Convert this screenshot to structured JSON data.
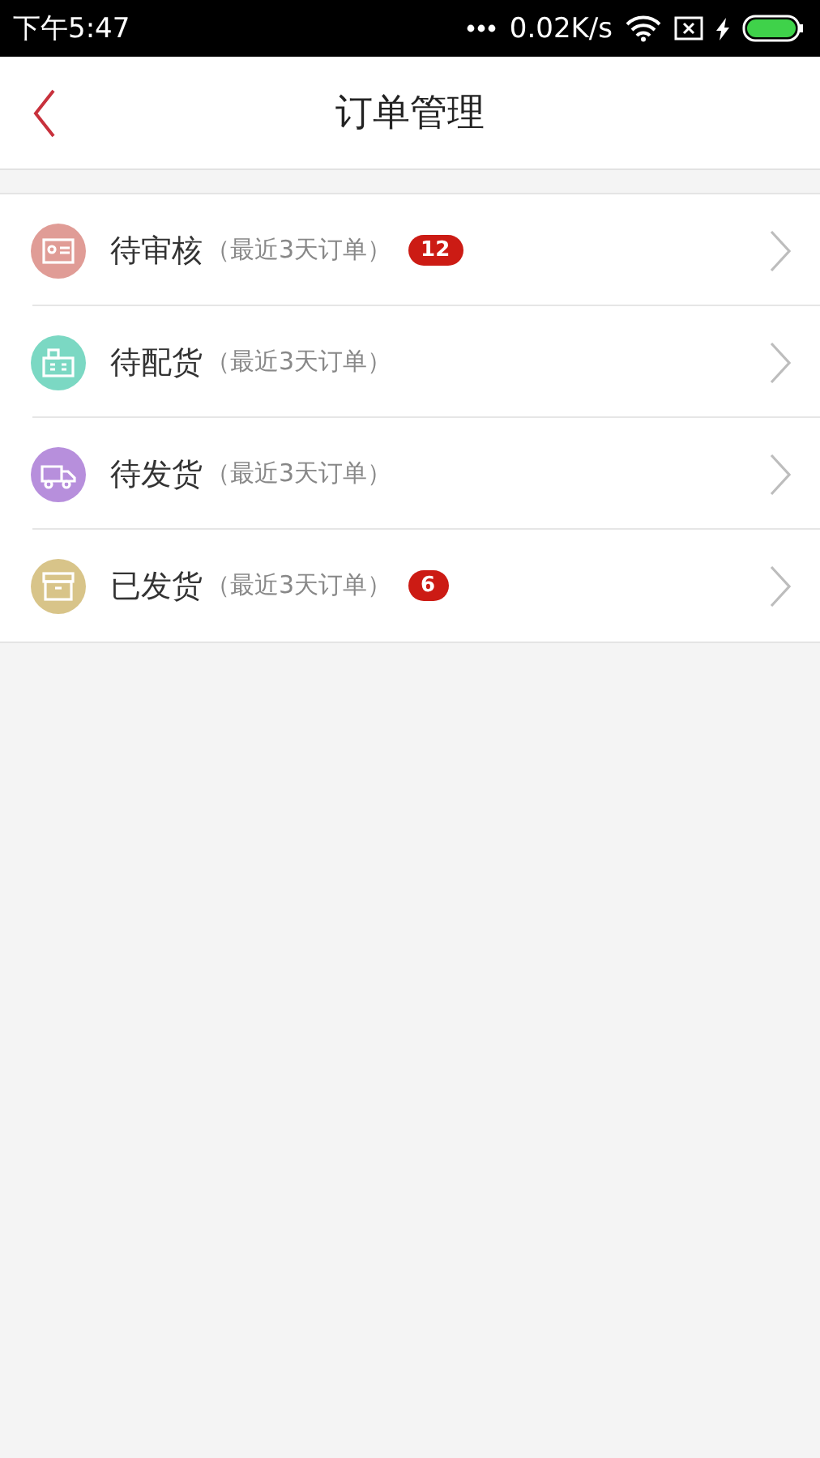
{
  "status_bar": {
    "time": "下午5:47",
    "speed": "0.02K/s",
    "charging": true
  },
  "header": {
    "title": "订单管理"
  },
  "rows": [
    {
      "kind": "review",
      "color": "#e09c96",
      "title": "待审核",
      "note": "（最近3天订单）",
      "badge": "12"
    },
    {
      "kind": "pack",
      "color": "#7bd8c3",
      "title": "待配货",
      "note": "（最近3天订单）"
    },
    {
      "kind": "ship",
      "color": "#b78fdc",
      "title": "待发货",
      "note": "（最近3天订单）"
    },
    {
      "kind": "shipped",
      "color": "#d8c489",
      "title": "已发货",
      "note": "（最近3天订单）",
      "badge": "6"
    }
  ]
}
